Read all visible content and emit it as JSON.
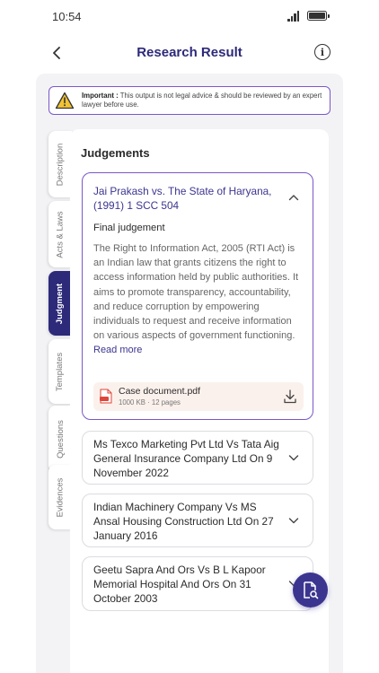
{
  "status_bar": {
    "time": "10:54"
  },
  "header": {
    "title": "Research Result"
  },
  "warning": {
    "label": "Important :",
    "text": "This output is not legal advice & should be reviewed by an expert lawyer before use."
  },
  "tabs": [
    {
      "label": "Description",
      "active": false
    },
    {
      "label": "Acts & Laws",
      "active": false
    },
    {
      "label": "Judgment",
      "active": true
    },
    {
      "label": "Templates",
      "active": false
    },
    {
      "label": "Questions",
      "active": false
    },
    {
      "label": "Evidences",
      "active": false
    }
  ],
  "section_title": "Judgements",
  "expanded_case": {
    "title": "Jai Prakash vs. The State of Haryana, (1991) 1 SCC 504",
    "subtitle": "Final judgement",
    "body": "The Right to Information Act, 2005 (RTI Act) is an Indian law that grants citizens the right to access information held by public authorities. It aims to promote transparency, accountability, and reduce corruption by empowering individuals to request and receive information on various aspects of government functioning.",
    "read_more": "Read more",
    "document": {
      "name": "Case document.pdf",
      "size": "1000 KB",
      "pages": "12 pages"
    }
  },
  "cases": [
    {
      "title": "Ms Texco Marketing Pvt Ltd Vs Tata Aig General Insurance Company Ltd On 9 November 2022"
    },
    {
      "title": "Indian Machinery Company Vs MS Ansal Housing Construction Ltd On 27 January 2016"
    },
    {
      "title": "Geetu Sapra And Ors Vs  B L Kapoor Memorial Hospital And Ors On 31 October 2003"
    }
  ],
  "colors": {
    "primary": "#3b3590",
    "accent_border": "#7a57c8",
    "doc_bg": "#fbf1ec",
    "warning": "#f2c232"
  },
  "icons": {
    "back": "chevron-left-icon",
    "info": "info-icon",
    "warning": "warning-icon",
    "collapse": "chevron-up-icon",
    "expand": "chevron-down-icon",
    "pdf": "pdf-icon",
    "download": "download-icon",
    "fab": "document-search-icon"
  }
}
